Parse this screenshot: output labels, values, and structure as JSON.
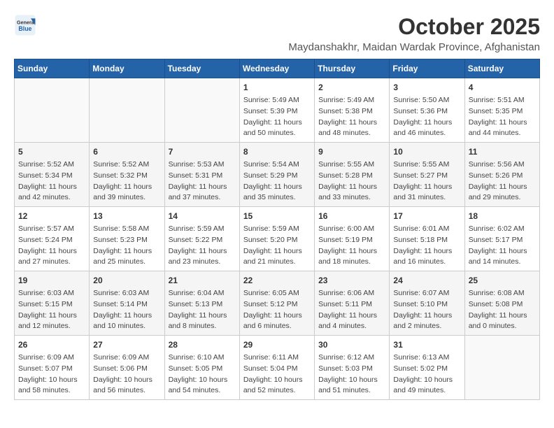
{
  "header": {
    "logo_general": "General",
    "logo_blue": "Blue",
    "month": "October 2025",
    "location": "Maydanshakhr, Maidan Wardak Province, Afghanistan"
  },
  "days_of_week": [
    "Sunday",
    "Monday",
    "Tuesday",
    "Wednesday",
    "Thursday",
    "Friday",
    "Saturday"
  ],
  "weeks": [
    [
      {
        "day": "",
        "info": ""
      },
      {
        "day": "",
        "info": ""
      },
      {
        "day": "",
        "info": ""
      },
      {
        "day": "1",
        "info": "Sunrise: 5:49 AM\nSunset: 5:39 PM\nDaylight: 11 hours\nand 50 minutes."
      },
      {
        "day": "2",
        "info": "Sunrise: 5:49 AM\nSunset: 5:38 PM\nDaylight: 11 hours\nand 48 minutes."
      },
      {
        "day": "3",
        "info": "Sunrise: 5:50 AM\nSunset: 5:36 PM\nDaylight: 11 hours\nand 46 minutes."
      },
      {
        "day": "4",
        "info": "Sunrise: 5:51 AM\nSunset: 5:35 PM\nDaylight: 11 hours\nand 44 minutes."
      }
    ],
    [
      {
        "day": "5",
        "info": "Sunrise: 5:52 AM\nSunset: 5:34 PM\nDaylight: 11 hours\nand 42 minutes."
      },
      {
        "day": "6",
        "info": "Sunrise: 5:52 AM\nSunset: 5:32 PM\nDaylight: 11 hours\nand 39 minutes."
      },
      {
        "day": "7",
        "info": "Sunrise: 5:53 AM\nSunset: 5:31 PM\nDaylight: 11 hours\nand 37 minutes."
      },
      {
        "day": "8",
        "info": "Sunrise: 5:54 AM\nSunset: 5:29 PM\nDaylight: 11 hours\nand 35 minutes."
      },
      {
        "day": "9",
        "info": "Sunrise: 5:55 AM\nSunset: 5:28 PM\nDaylight: 11 hours\nand 33 minutes."
      },
      {
        "day": "10",
        "info": "Sunrise: 5:55 AM\nSunset: 5:27 PM\nDaylight: 11 hours\nand 31 minutes."
      },
      {
        "day": "11",
        "info": "Sunrise: 5:56 AM\nSunset: 5:26 PM\nDaylight: 11 hours\nand 29 minutes."
      }
    ],
    [
      {
        "day": "12",
        "info": "Sunrise: 5:57 AM\nSunset: 5:24 PM\nDaylight: 11 hours\nand 27 minutes."
      },
      {
        "day": "13",
        "info": "Sunrise: 5:58 AM\nSunset: 5:23 PM\nDaylight: 11 hours\nand 25 minutes."
      },
      {
        "day": "14",
        "info": "Sunrise: 5:59 AM\nSunset: 5:22 PM\nDaylight: 11 hours\nand 23 minutes."
      },
      {
        "day": "15",
        "info": "Sunrise: 5:59 AM\nSunset: 5:20 PM\nDaylight: 11 hours\nand 21 minutes."
      },
      {
        "day": "16",
        "info": "Sunrise: 6:00 AM\nSunset: 5:19 PM\nDaylight: 11 hours\nand 18 minutes."
      },
      {
        "day": "17",
        "info": "Sunrise: 6:01 AM\nSunset: 5:18 PM\nDaylight: 11 hours\nand 16 minutes."
      },
      {
        "day": "18",
        "info": "Sunrise: 6:02 AM\nSunset: 5:17 PM\nDaylight: 11 hours\nand 14 minutes."
      }
    ],
    [
      {
        "day": "19",
        "info": "Sunrise: 6:03 AM\nSunset: 5:15 PM\nDaylight: 11 hours\nand 12 minutes."
      },
      {
        "day": "20",
        "info": "Sunrise: 6:03 AM\nSunset: 5:14 PM\nDaylight: 11 hours\nand 10 minutes."
      },
      {
        "day": "21",
        "info": "Sunrise: 6:04 AM\nSunset: 5:13 PM\nDaylight: 11 hours\nand 8 minutes."
      },
      {
        "day": "22",
        "info": "Sunrise: 6:05 AM\nSunset: 5:12 PM\nDaylight: 11 hours\nand 6 minutes."
      },
      {
        "day": "23",
        "info": "Sunrise: 6:06 AM\nSunset: 5:11 PM\nDaylight: 11 hours\nand 4 minutes."
      },
      {
        "day": "24",
        "info": "Sunrise: 6:07 AM\nSunset: 5:10 PM\nDaylight: 11 hours\nand 2 minutes."
      },
      {
        "day": "25",
        "info": "Sunrise: 6:08 AM\nSunset: 5:08 PM\nDaylight: 11 hours\nand 0 minutes."
      }
    ],
    [
      {
        "day": "26",
        "info": "Sunrise: 6:09 AM\nSunset: 5:07 PM\nDaylight: 10 hours\nand 58 minutes."
      },
      {
        "day": "27",
        "info": "Sunrise: 6:09 AM\nSunset: 5:06 PM\nDaylight: 10 hours\nand 56 minutes."
      },
      {
        "day": "28",
        "info": "Sunrise: 6:10 AM\nSunset: 5:05 PM\nDaylight: 10 hours\nand 54 minutes."
      },
      {
        "day": "29",
        "info": "Sunrise: 6:11 AM\nSunset: 5:04 PM\nDaylight: 10 hours\nand 52 minutes."
      },
      {
        "day": "30",
        "info": "Sunrise: 6:12 AM\nSunset: 5:03 PM\nDaylight: 10 hours\nand 51 minutes."
      },
      {
        "day": "31",
        "info": "Sunrise: 6:13 AM\nSunset: 5:02 PM\nDaylight: 10 hours\nand 49 minutes."
      },
      {
        "day": "",
        "info": ""
      }
    ]
  ]
}
